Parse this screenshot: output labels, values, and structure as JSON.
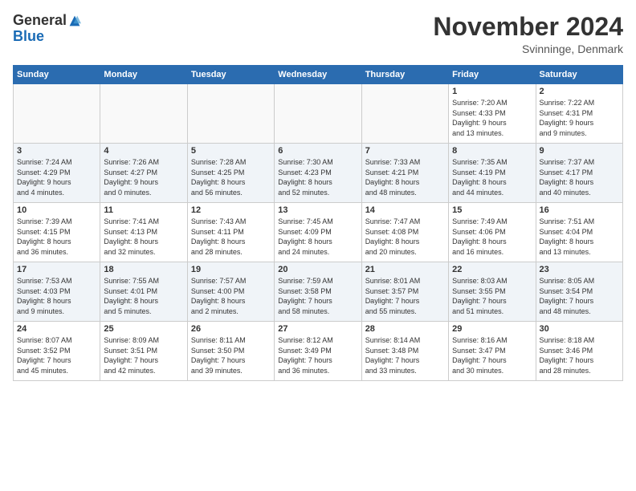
{
  "header": {
    "logo_general": "General",
    "logo_blue": "Blue",
    "month_title": "November 2024",
    "location": "Svinninge, Denmark"
  },
  "days_of_week": [
    "Sunday",
    "Monday",
    "Tuesday",
    "Wednesday",
    "Thursday",
    "Friday",
    "Saturday"
  ],
  "weeks": [
    {
      "row_class": "row-odd",
      "days": [
        {
          "number": "",
          "info": "",
          "empty": true
        },
        {
          "number": "",
          "info": "",
          "empty": true
        },
        {
          "number": "",
          "info": "",
          "empty": true
        },
        {
          "number": "",
          "info": "",
          "empty": true
        },
        {
          "number": "",
          "info": "",
          "empty": true
        },
        {
          "number": "1",
          "info": "Sunrise: 7:20 AM\nSunset: 4:33 PM\nDaylight: 9 hours\nand 13 minutes."
        },
        {
          "number": "2",
          "info": "Sunrise: 7:22 AM\nSunset: 4:31 PM\nDaylight: 9 hours\nand 9 minutes."
        }
      ]
    },
    {
      "row_class": "row-even",
      "days": [
        {
          "number": "3",
          "info": "Sunrise: 7:24 AM\nSunset: 4:29 PM\nDaylight: 9 hours\nand 4 minutes."
        },
        {
          "number": "4",
          "info": "Sunrise: 7:26 AM\nSunset: 4:27 PM\nDaylight: 9 hours\nand 0 minutes."
        },
        {
          "number": "5",
          "info": "Sunrise: 7:28 AM\nSunset: 4:25 PM\nDaylight: 8 hours\nand 56 minutes."
        },
        {
          "number": "6",
          "info": "Sunrise: 7:30 AM\nSunset: 4:23 PM\nDaylight: 8 hours\nand 52 minutes."
        },
        {
          "number": "7",
          "info": "Sunrise: 7:33 AM\nSunset: 4:21 PM\nDaylight: 8 hours\nand 48 minutes."
        },
        {
          "number": "8",
          "info": "Sunrise: 7:35 AM\nSunset: 4:19 PM\nDaylight: 8 hours\nand 44 minutes."
        },
        {
          "number": "9",
          "info": "Sunrise: 7:37 AM\nSunset: 4:17 PM\nDaylight: 8 hours\nand 40 minutes."
        }
      ]
    },
    {
      "row_class": "row-odd",
      "days": [
        {
          "number": "10",
          "info": "Sunrise: 7:39 AM\nSunset: 4:15 PM\nDaylight: 8 hours\nand 36 minutes."
        },
        {
          "number": "11",
          "info": "Sunrise: 7:41 AM\nSunset: 4:13 PM\nDaylight: 8 hours\nand 32 minutes."
        },
        {
          "number": "12",
          "info": "Sunrise: 7:43 AM\nSunset: 4:11 PM\nDaylight: 8 hours\nand 28 minutes."
        },
        {
          "number": "13",
          "info": "Sunrise: 7:45 AM\nSunset: 4:09 PM\nDaylight: 8 hours\nand 24 minutes."
        },
        {
          "number": "14",
          "info": "Sunrise: 7:47 AM\nSunset: 4:08 PM\nDaylight: 8 hours\nand 20 minutes."
        },
        {
          "number": "15",
          "info": "Sunrise: 7:49 AM\nSunset: 4:06 PM\nDaylight: 8 hours\nand 16 minutes."
        },
        {
          "number": "16",
          "info": "Sunrise: 7:51 AM\nSunset: 4:04 PM\nDaylight: 8 hours\nand 13 minutes."
        }
      ]
    },
    {
      "row_class": "row-even",
      "days": [
        {
          "number": "17",
          "info": "Sunrise: 7:53 AM\nSunset: 4:03 PM\nDaylight: 8 hours\nand 9 minutes."
        },
        {
          "number": "18",
          "info": "Sunrise: 7:55 AM\nSunset: 4:01 PM\nDaylight: 8 hours\nand 5 minutes."
        },
        {
          "number": "19",
          "info": "Sunrise: 7:57 AM\nSunset: 4:00 PM\nDaylight: 8 hours\nand 2 minutes."
        },
        {
          "number": "20",
          "info": "Sunrise: 7:59 AM\nSunset: 3:58 PM\nDaylight: 7 hours\nand 58 minutes."
        },
        {
          "number": "21",
          "info": "Sunrise: 8:01 AM\nSunset: 3:57 PM\nDaylight: 7 hours\nand 55 minutes."
        },
        {
          "number": "22",
          "info": "Sunrise: 8:03 AM\nSunset: 3:55 PM\nDaylight: 7 hours\nand 51 minutes."
        },
        {
          "number": "23",
          "info": "Sunrise: 8:05 AM\nSunset: 3:54 PM\nDaylight: 7 hours\nand 48 minutes."
        }
      ]
    },
    {
      "row_class": "row-odd",
      "days": [
        {
          "number": "24",
          "info": "Sunrise: 8:07 AM\nSunset: 3:52 PM\nDaylight: 7 hours\nand 45 minutes."
        },
        {
          "number": "25",
          "info": "Sunrise: 8:09 AM\nSunset: 3:51 PM\nDaylight: 7 hours\nand 42 minutes."
        },
        {
          "number": "26",
          "info": "Sunrise: 8:11 AM\nSunset: 3:50 PM\nDaylight: 7 hours\nand 39 minutes."
        },
        {
          "number": "27",
          "info": "Sunrise: 8:12 AM\nSunset: 3:49 PM\nDaylight: 7 hours\nand 36 minutes."
        },
        {
          "number": "28",
          "info": "Sunrise: 8:14 AM\nSunset: 3:48 PM\nDaylight: 7 hours\nand 33 minutes."
        },
        {
          "number": "29",
          "info": "Sunrise: 8:16 AM\nSunset: 3:47 PM\nDaylight: 7 hours\nand 30 minutes."
        },
        {
          "number": "30",
          "info": "Sunrise: 8:18 AM\nSunset: 3:46 PM\nDaylight: 7 hours\nand 28 minutes."
        }
      ]
    }
  ]
}
